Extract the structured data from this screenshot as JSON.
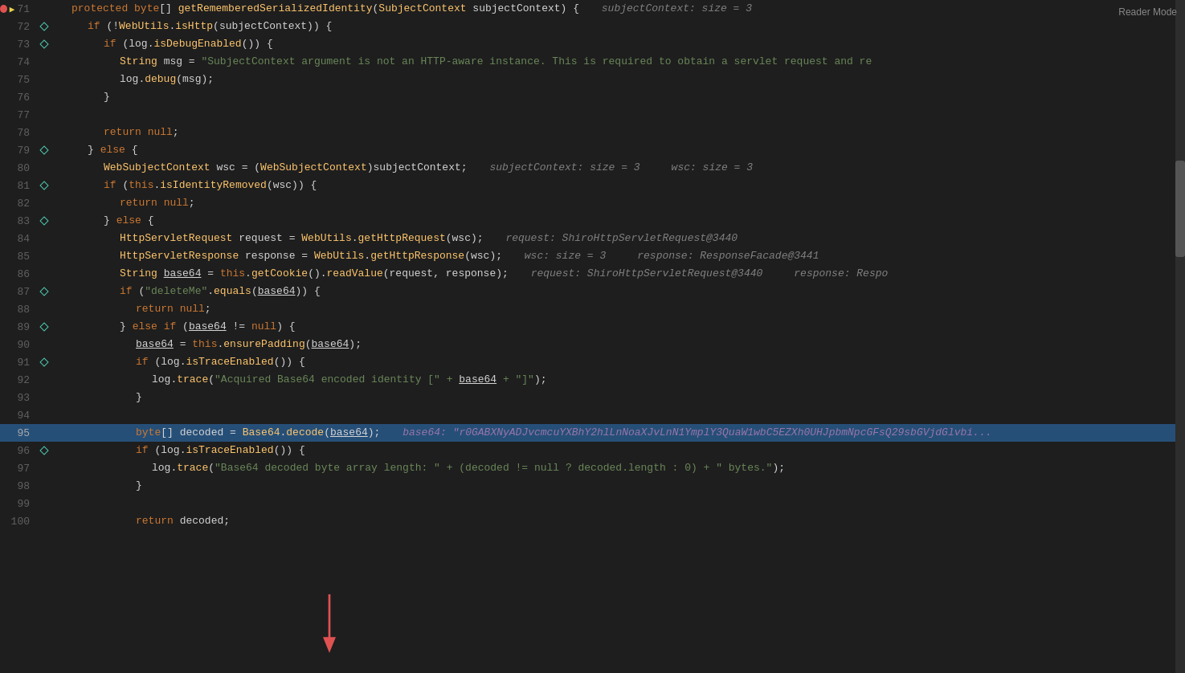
{
  "reader_mode": "Reader Mode",
  "lines": [
    {
      "num": 71,
      "has_breakpoint": true,
      "has_debug_arrow": true,
      "gutter": "none",
      "content": "protected_byte_getRememberedSerializedIdentity",
      "indent": 1
    },
    {
      "num": 72,
      "gutter": "diamond_outline",
      "indent": 2
    },
    {
      "num": 73,
      "gutter": "diamond_outline",
      "indent": 3
    },
    {
      "num": 74,
      "gutter": "none",
      "indent": 4
    },
    {
      "num": 75,
      "gutter": "none",
      "indent": 4
    },
    {
      "num": 76,
      "gutter": "none",
      "indent": 3
    },
    {
      "num": 77,
      "gutter": "none",
      "indent": 0
    },
    {
      "num": 78,
      "gutter": "none",
      "indent": 3
    },
    {
      "num": 79,
      "gutter": "diamond_outline",
      "indent": 2
    },
    {
      "num": 80,
      "gutter": "none",
      "indent": 3
    },
    {
      "num": 81,
      "gutter": "diamond_outline",
      "indent": 3
    },
    {
      "num": 82,
      "gutter": "none",
      "indent": 4
    },
    {
      "num": 83,
      "gutter": "diamond_outline",
      "indent": 3
    },
    {
      "num": 84,
      "gutter": "none",
      "indent": 4
    },
    {
      "num": 85,
      "gutter": "none",
      "indent": 4
    },
    {
      "num": 86,
      "gutter": "none",
      "indent": 4
    },
    {
      "num": 87,
      "gutter": "diamond_outline",
      "indent": 4
    },
    {
      "num": 88,
      "gutter": "none",
      "indent": 5
    },
    {
      "num": 89,
      "gutter": "diamond_outline",
      "indent": 4
    },
    {
      "num": 90,
      "gutter": "none",
      "indent": 5
    },
    {
      "num": 91,
      "gutter": "diamond_outline",
      "indent": 5
    },
    {
      "num": 92,
      "gutter": "none",
      "indent": 6
    },
    {
      "num": 93,
      "gutter": "none",
      "indent": 5
    },
    {
      "num": 94,
      "gutter": "none",
      "indent": 0
    },
    {
      "num": 95,
      "highlighted": true,
      "gutter": "none",
      "indent": 5
    },
    {
      "num": 96,
      "gutter": "diamond_outline",
      "indent": 5
    },
    {
      "num": 97,
      "gutter": "none",
      "indent": 6
    },
    {
      "num": 98,
      "gutter": "none",
      "indent": 5
    },
    {
      "num": 99,
      "gutter": "none",
      "indent": 0
    },
    {
      "num": 100,
      "gutter": "none",
      "indent": 5
    }
  ]
}
